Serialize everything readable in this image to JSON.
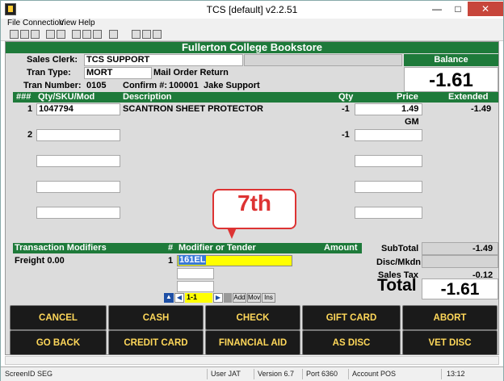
{
  "window": {
    "title": "TCS [default]  v2.2.51"
  },
  "menu": [
    "File",
    "Connection",
    "View",
    "Help"
  ],
  "store_title": "Fullerton College Bookstore",
  "header": {
    "sales_clerk_label": "Sales Clerk:",
    "sales_clerk_value": "TCS SUPPORT",
    "tran_type_label": "Tran Type:",
    "tran_type_value": "MORT",
    "tran_type_desc": "Mail Order Return",
    "tran_number_label": "Tran Number:",
    "tran_number_value": "0105",
    "confirm_label": "Confirm #:",
    "confirm_value": "100001",
    "confirm_name": "Jake Support"
  },
  "balance": {
    "label": "Balance",
    "value": "-1.61"
  },
  "grid": {
    "headers": [
      "###",
      "Qty/SKU/Mod",
      "Description",
      "Qty",
      "Price",
      "Extended"
    ],
    "rows": [
      {
        "num": "1",
        "sku": "1047794",
        "desc": "SCANTRON SHEET PROTECTOR",
        "qty": "-1",
        "price": "1.49",
        "ext": "-1.49",
        "sub": "GM"
      },
      {
        "num": "2",
        "sku": "",
        "desc": "",
        "qty": "-1",
        "price": "",
        "ext": "",
        "sub": ""
      }
    ]
  },
  "callout": "7th",
  "modifiers": {
    "headers": [
      "Transaction Modifiers",
      "#",
      "Modifier or Tender",
      "Amount"
    ],
    "rows": [
      {
        "label": "Freight 0.00",
        "num": "1",
        "tender": "161EL",
        "amount": ""
      }
    ],
    "pager": "1-1",
    "add": "Add",
    "mov": "Mov",
    "ins": "Ins"
  },
  "totals": {
    "subtotal_label": "SubTotal",
    "subtotal_value": "-1.49",
    "disc_label": "Disc/Mkdn",
    "disc_value": "",
    "tax_label": "Sales Tax",
    "tax_value": "-0.12",
    "total_label": "Total",
    "total_value": "-1.61"
  },
  "buttons": {
    "row1": [
      "CANCEL",
      "CASH",
      "CHECK",
      "GIFT CARD",
      "ABORT"
    ],
    "row2": [
      "GO BACK",
      "CREDIT CARD",
      "FINANCIAL AID",
      "AS DISC",
      "VET DISC"
    ]
  },
  "status": {
    "screen": "ScreenID SEG",
    "user": "User JAT",
    "version": "Version 6.7",
    "port": "Port 6360",
    "account": "Account POS",
    "time": "13:12"
  }
}
